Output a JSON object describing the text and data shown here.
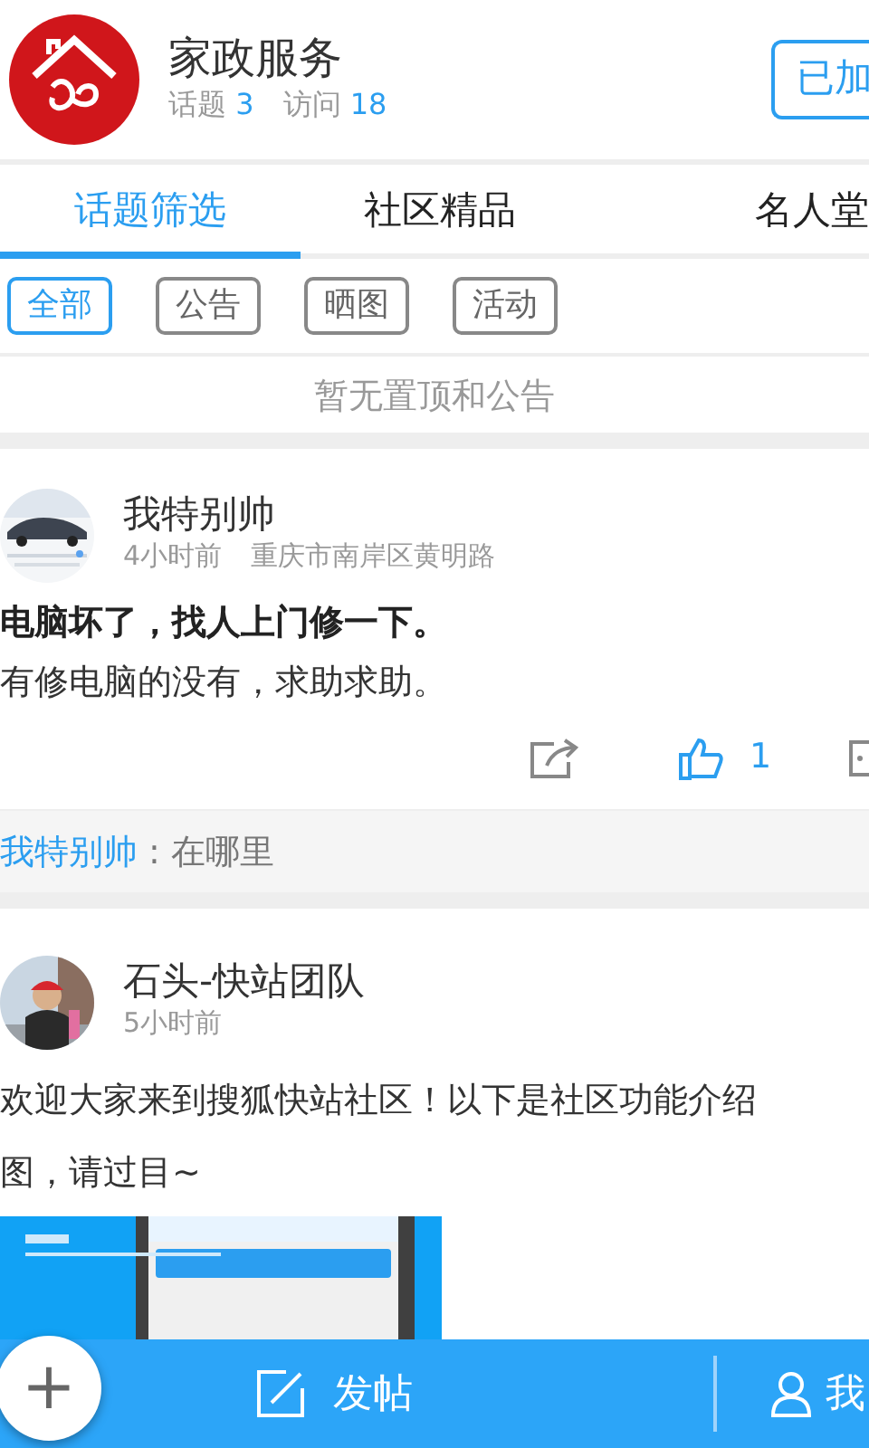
{
  "community": {
    "name": "家政服务",
    "topics_label": "话题",
    "topics": "3",
    "visits_label": "访问",
    "visits": "18",
    "join_button": "已加"
  },
  "tabs": [
    {
      "label": "话题筛选",
      "selected": true
    },
    {
      "label": "社区精品",
      "selected": false
    },
    {
      "label": "名人堂",
      "selected": false
    }
  ],
  "filters": [
    {
      "label": "全部",
      "selected": true
    },
    {
      "label": "公告",
      "selected": false
    },
    {
      "label": "晒图",
      "selected": false
    },
    {
      "label": "活动",
      "selected": false
    }
  ],
  "notice": "暂无置顶和公告",
  "posts": [
    {
      "author": "我特别帅",
      "time": "4小时前",
      "location": "重庆市南岸区黄明路",
      "title": "电脑坏了，找人上门修一下。",
      "lines": [
        "有修电脑的没有，求助求助。"
      ],
      "likes": "1",
      "comment": {
        "author": "我特别帅",
        "text": " : 在哪里"
      }
    },
    {
      "author": "石头-快站团队",
      "time": "5小时前",
      "lines": [
        "欢迎大家来到搜狐快站社区！以下是社区功能介绍",
        "图，请过目~"
      ],
      "image": {
        "kind": "picture"
      }
    }
  ],
  "bottom_bar": {
    "fab": "+",
    "post_label": "发帖",
    "me_label": "我"
  }
}
